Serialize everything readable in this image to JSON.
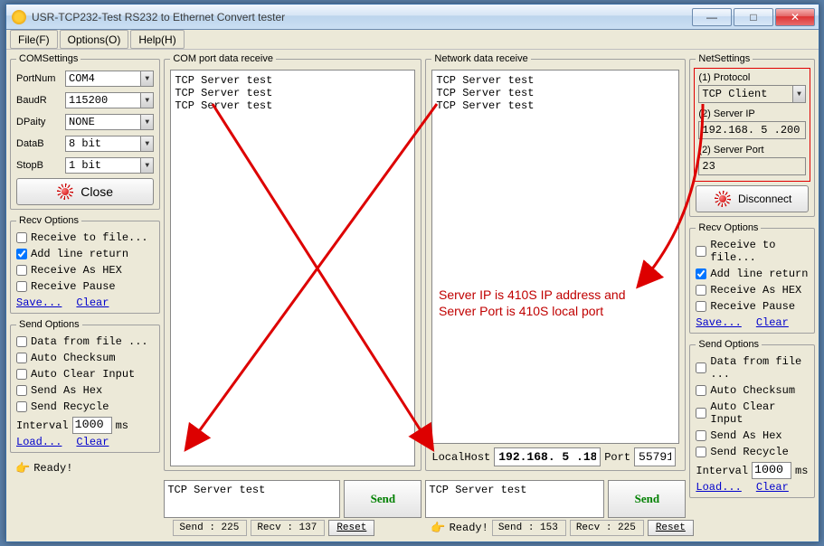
{
  "title": "USR-TCP232-Test  RS232 to Ethernet Convert tester",
  "menu": {
    "file": "File(F)",
    "options": "Options(O)",
    "help": "Help(H)"
  },
  "com_settings": {
    "legend": "COMSettings",
    "portnum_lbl": "PortNum",
    "portnum": "COM4",
    "baud_lbl": "BaudR",
    "baud": "115200",
    "parity_lbl": "DPaity",
    "parity": "NONE",
    "datab_lbl": "DataB",
    "datab": "8 bit",
    "stopb_lbl": "StopB",
    "stopb": "1 bit",
    "close_btn": "Close"
  },
  "recv_opts": {
    "legend": "Recv Options",
    "to_file": "Receive to file...",
    "line_return": "Add line return",
    "as_hex": "Receive As HEX",
    "pause": "Receive Pause",
    "save": "Save...",
    "clear": "Clear"
  },
  "send_opts": {
    "legend": "Send Options",
    "from_file": "Data from file ...",
    "auto_checksum": "Auto Checksum",
    "auto_clear": "Auto Clear Input",
    "as_hex": "Send As Hex",
    "recycle": "Send Recycle",
    "interval_lbl": "Interval",
    "interval_val": "1000",
    "interval_unit": "ms",
    "load": "Load...",
    "clear": "Clear"
  },
  "com_receive": {
    "legend": "COM port data receive",
    "lines": "TCP Server test\nTCP Server test\nTCP Server test",
    "send_text": "TCP Server test",
    "send_btn": "Send",
    "status_ready": "Ready!",
    "status_send": "Send : 225",
    "status_recv": "Recv : 137",
    "reset": "Reset"
  },
  "net_receive": {
    "legend": "Network data receive",
    "lines": "TCP Server test\nTCP Server test\nTCP Server test",
    "localhost_lbl": "LocalHost",
    "localhost_val": "192.168. 5 .18",
    "port_lbl": "Port",
    "port_val": "55791",
    "send_text": "TCP Server test",
    "send_btn": "Send",
    "status_ready": "Ready!",
    "status_send": "Send : 153",
    "status_recv": "Recv : 225",
    "reset": "Reset"
  },
  "net_settings": {
    "legend": "NetSettings",
    "proto_lbl": "(1) Protocol",
    "proto": "TCP Client",
    "ip_lbl": "(2) Server IP",
    "ip": "192.168. 5 .200",
    "port_lbl": "(2) Server Port",
    "port": "23",
    "disconnect_btn": "Disconnect"
  },
  "annotation": {
    "line1": "Server IP is 410S IP address and",
    "line2": "Server Port is 410S local port"
  }
}
